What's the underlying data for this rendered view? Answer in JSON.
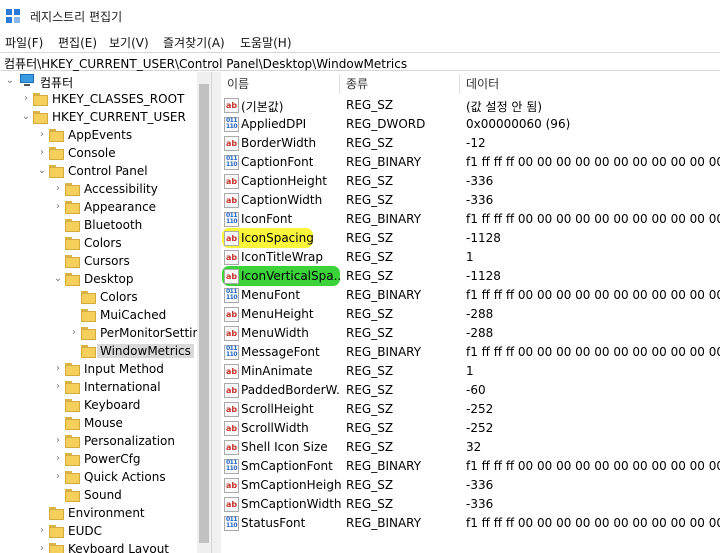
{
  "window": {
    "title": "레지스트리 편집기"
  },
  "menu": [
    "파일(F)",
    "편집(E)",
    "보기(V)",
    "즐겨찾기(A)",
    "도움말(H)"
  ],
  "address": "컴퓨터\\HKEY_CURRENT_USER\\Control Panel\\Desktop\\WindowMetrics",
  "tree": {
    "root": "컴퓨터",
    "items": [
      {
        "label": "HKEY_CLASSES_ROOT",
        "expander": "›"
      },
      {
        "label": "HKEY_CURRENT_USER",
        "expander": "⌄"
      },
      {
        "label": "AppEvents",
        "expander": "›"
      },
      {
        "label": "Console",
        "expander": "›"
      },
      {
        "label": "Control Panel",
        "expander": "⌄"
      },
      {
        "label": "Accessibility",
        "expander": "›"
      },
      {
        "label": "Appearance",
        "expander": "›"
      },
      {
        "label": "Bluetooth",
        "expander": ""
      },
      {
        "label": "Colors",
        "expander": ""
      },
      {
        "label": "Cursors",
        "expander": ""
      },
      {
        "label": "Desktop",
        "expander": "⌄"
      },
      {
        "label": "Colors",
        "expander": ""
      },
      {
        "label": "MuiCached",
        "expander": ""
      },
      {
        "label": "PerMonitorSettin",
        "expander": "›"
      },
      {
        "label": "WindowMetrics",
        "expander": ""
      },
      {
        "label": "Input Method",
        "expander": "›"
      },
      {
        "label": "International",
        "expander": "›"
      },
      {
        "label": "Keyboard",
        "expander": ""
      },
      {
        "label": "Mouse",
        "expander": ""
      },
      {
        "label": "Personalization",
        "expander": "›"
      },
      {
        "label": "PowerCfg",
        "expander": "›"
      },
      {
        "label": "Quick Actions",
        "expander": "›"
      },
      {
        "label": "Sound",
        "expander": ""
      },
      {
        "label": "Environment",
        "expander": ""
      },
      {
        "label": "EUDC",
        "expander": "›"
      },
      {
        "label": "Keyboard Layout",
        "expander": "›"
      }
    ]
  },
  "columns": {
    "name": "이름",
    "type": "종류",
    "data": "데이터"
  },
  "values": [
    {
      "name": "(기본값)",
      "type": "REG_SZ",
      "data": "(값 설정 안 됨)",
      "icon": "ab"
    },
    {
      "name": "AppliedDPI",
      "type": "REG_DWORD",
      "data": "0x00000060 (96)",
      "icon": "bin"
    },
    {
      "name": "BorderWidth",
      "type": "REG_SZ",
      "data": "-12",
      "icon": "ab"
    },
    {
      "name": "CaptionFont",
      "type": "REG_BINARY",
      "data": "f1 ff ff ff 00 00 00 00 00 00 00 00 00 00 00",
      "icon": "bin"
    },
    {
      "name": "CaptionHeight",
      "type": "REG_SZ",
      "data": "-336",
      "icon": "ab"
    },
    {
      "name": "CaptionWidth",
      "type": "REG_SZ",
      "data": "-336",
      "icon": "ab"
    },
    {
      "name": "IconFont",
      "type": "REG_BINARY",
      "data": "f1 ff ff ff 00 00 00 00 00 00 00 00 00 00 00",
      "icon": "bin"
    },
    {
      "name": "IconSpacing",
      "type": "REG_SZ",
      "data": "-1128",
      "icon": "ab",
      "highlight": "yellow"
    },
    {
      "name": "IconTitleWrap",
      "type": "REG_SZ",
      "data": "1",
      "icon": "ab"
    },
    {
      "name": "IconVerticalSpa...",
      "type": "REG_SZ",
      "data": "-1128",
      "icon": "ab",
      "highlight": "green"
    },
    {
      "name": "MenuFont",
      "type": "REG_BINARY",
      "data": "f1 ff ff ff 00 00 00 00 00 00 00 00 00 00 00",
      "icon": "bin"
    },
    {
      "name": "MenuHeight",
      "type": "REG_SZ",
      "data": "-288",
      "icon": "ab"
    },
    {
      "name": "MenuWidth",
      "type": "REG_SZ",
      "data": "-288",
      "icon": "ab"
    },
    {
      "name": "MessageFont",
      "type": "REG_BINARY",
      "data": "f1 ff ff ff 00 00 00 00 00 00 00 00 00 00 00",
      "icon": "bin"
    },
    {
      "name": "MinAnimate",
      "type": "REG_SZ",
      "data": "1",
      "icon": "ab"
    },
    {
      "name": "PaddedBorderW...",
      "type": "REG_SZ",
      "data": "-60",
      "icon": "ab"
    },
    {
      "name": "ScrollHeight",
      "type": "REG_SZ",
      "data": "-252",
      "icon": "ab"
    },
    {
      "name": "ScrollWidth",
      "type": "REG_SZ",
      "data": "-252",
      "icon": "ab"
    },
    {
      "name": "Shell Icon Size",
      "type": "REG_SZ",
      "data": "32",
      "icon": "ab"
    },
    {
      "name": "SmCaptionFont",
      "type": "REG_BINARY",
      "data": "f1 ff ff ff 00 00 00 00 00 00 00 00 00 00 00",
      "icon": "bin"
    },
    {
      "name": "SmCaptionHeight",
      "type": "REG_SZ",
      "data": "-336",
      "icon": "ab"
    },
    {
      "name": "SmCaptionWidth",
      "type": "REG_SZ",
      "data": "-336",
      "icon": "ab"
    },
    {
      "name": "StatusFont",
      "type": "REG_BINARY",
      "data": "f1 ff ff ff 00 00 00 00 00 00 00 00 00 00 00",
      "icon": "bin"
    }
  ],
  "colors": {
    "highlight_yellow": "#f8f53a",
    "highlight_green": "#3cd33a",
    "folder": "#f4cf5c",
    "selection": "#d9d9d9"
  }
}
